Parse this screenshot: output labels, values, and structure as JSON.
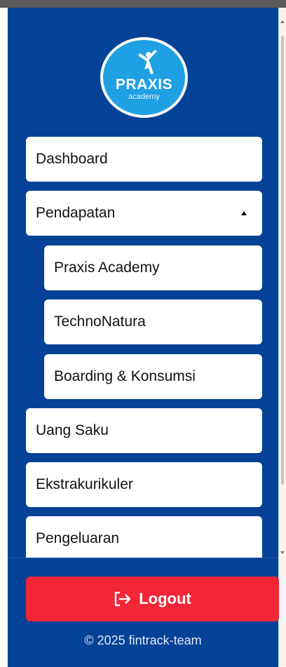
{
  "logo": {
    "word": "PRAXIS",
    "sub": "academy"
  },
  "nav": {
    "dashboard": "Dashboard",
    "pendapatan": "Pendapatan",
    "pendapatan_sub": [
      "Praxis Academy",
      "TechnoNatura",
      "Boarding & Konsumsi"
    ],
    "uang_saku": "Uang Saku",
    "ekstrakurikuler": "Ekstrakurikuler",
    "pengeluaran": "Pengeluaran"
  },
  "logout": {
    "label": "Logout",
    "icon": "logout-icon"
  },
  "footer": {
    "copyright": "© 2025 fintrack-team"
  },
  "colors": {
    "sidebar_bg": "#034296",
    "logo_bg": "#1fa0e3",
    "logout_bg": "#f22637"
  }
}
